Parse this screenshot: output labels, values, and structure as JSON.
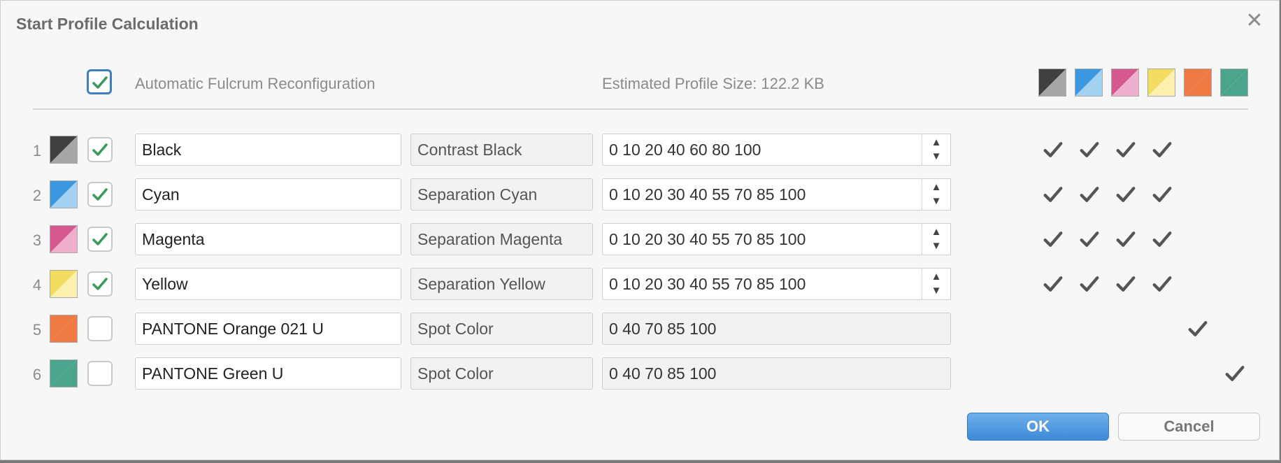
{
  "dialog": {
    "title": "Start Profile Calculation",
    "close_glyph": "✕",
    "auto_reconfig": {
      "label": "Automatic Fulcrum Reconfiguration",
      "checked": true
    },
    "estimated_size": "Estimated Profile Size: 122.2 KB",
    "header_swatches": [
      {
        "name": "black",
        "colors": [
          "#404040",
          "#a6a6a6"
        ]
      },
      {
        "name": "cyan",
        "colors": [
          "#3a97e0",
          "#a3d2f2"
        ]
      },
      {
        "name": "magenta",
        "colors": [
          "#d5588e",
          "#eeb0cc"
        ]
      },
      {
        "name": "yellow",
        "colors": [
          "#f3dd60",
          "#fbf0ad"
        ]
      },
      {
        "name": "orange",
        "colors": [
          "#ef7a43",
          "#ef7a43"
        ]
      },
      {
        "name": "green",
        "colors": [
          "#4aa58c",
          "#4aa58c"
        ]
      }
    ],
    "rows": [
      {
        "num": "1",
        "checked": true,
        "name": "Black",
        "type": "Contrast Black",
        "steps": "0 10 20 40 60 80 100",
        "spinner": true,
        "colors": [
          "#404040",
          "#a6a6a6"
        ]
      },
      {
        "num": "2",
        "checked": true,
        "name": "Cyan",
        "type": "Separation Cyan",
        "steps": "0 10 20 30 40 55 70 85 100",
        "spinner": true,
        "colors": [
          "#3a97e0",
          "#a3d2f2"
        ]
      },
      {
        "num": "3",
        "checked": true,
        "name": "Magenta",
        "type": "Separation Magenta",
        "steps": "0 10 20 30 40 55 70 85 100",
        "spinner": true,
        "colors": [
          "#d5588e",
          "#eeb0cc"
        ]
      },
      {
        "num": "4",
        "checked": true,
        "name": "Yellow",
        "type": "Separation Yellow",
        "steps": "0 10 20 30 40 55 70 85 100",
        "spinner": true,
        "colors": [
          "#f3dd60",
          "#fbf0ad"
        ]
      },
      {
        "num": "5",
        "checked": false,
        "name": "PANTONE Orange 021 U",
        "type": "Spot Color",
        "steps": "0 40 70 85 100",
        "spinner": false,
        "colors": [
          "#ef7a43",
          "#ef7a43"
        ]
      },
      {
        "num": "6",
        "checked": false,
        "name": "PANTONE Green U",
        "type": "Spot Color",
        "steps": "0 40 70 85 100",
        "spinner": false,
        "colors": [
          "#4aa58c",
          "#4aa58c"
        ]
      }
    ],
    "ok_label": "OK",
    "cancel_label": "Cancel",
    "accent_color": "#3d8ad8",
    "check_color": "#3a9a57"
  }
}
